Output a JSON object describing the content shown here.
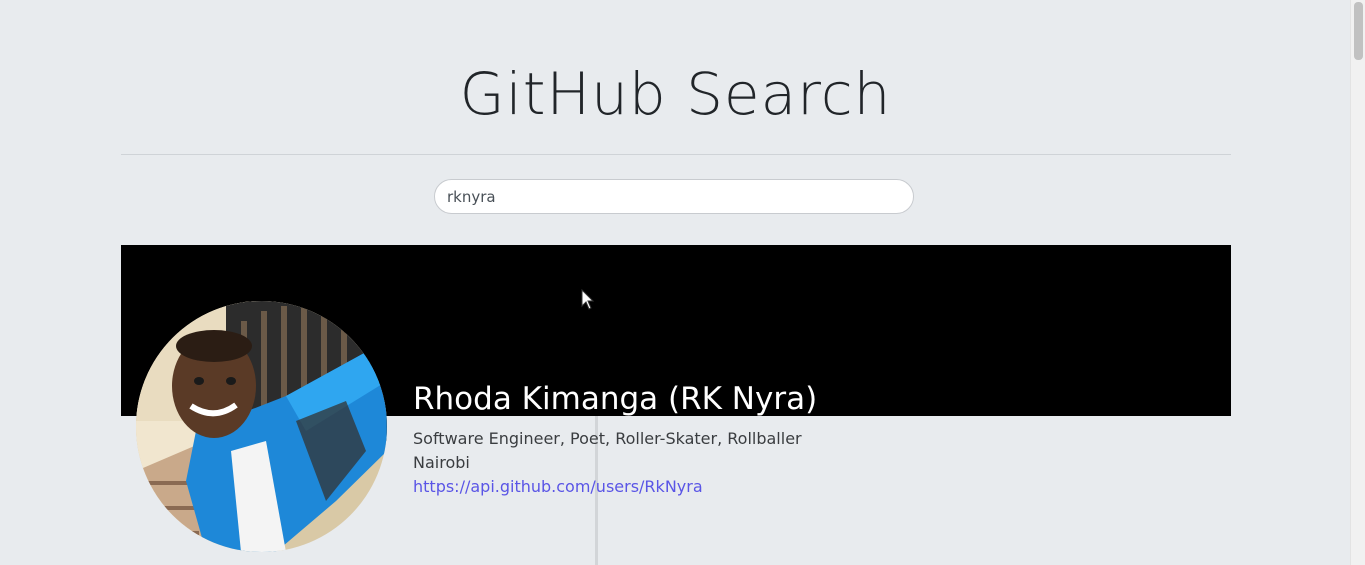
{
  "header": {
    "title": "GitHub Search"
  },
  "search": {
    "value": "rknyra"
  },
  "profile": {
    "name": "Rhoda Kimanga (RK Nyra)",
    "bio": "Software Engineer, Poet, Roller-Skater, Rollballer",
    "location": "Nairobi",
    "url": "https://api.github.com/users/RkNyra",
    "avatar_icon": "user-avatar-photo"
  },
  "colors": {
    "background": "#e8ebee",
    "banner": "#000000",
    "link": "#5a55e6"
  }
}
